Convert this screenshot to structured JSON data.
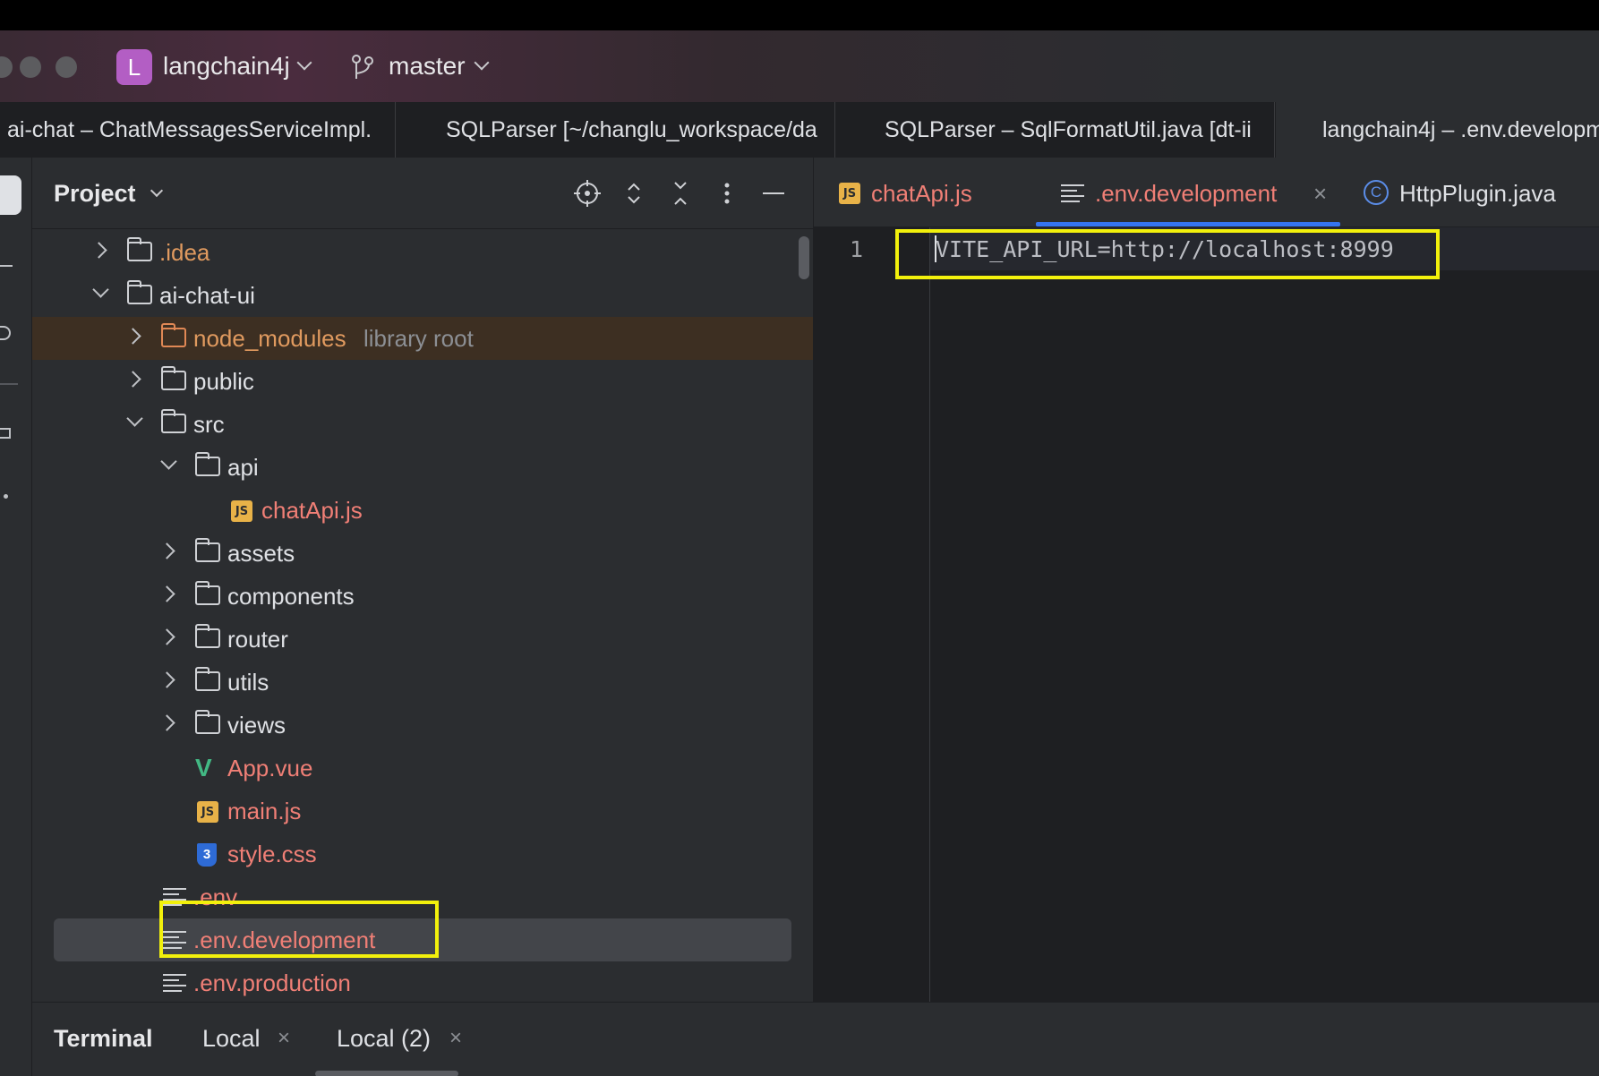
{
  "titlebar": {
    "project_initial": "L",
    "project_name": "langchain4j",
    "branch_name": "master"
  },
  "window_tabs": [
    {
      "label": "ai-chat – ChatMessagesServiceImpl."
    },
    {
      "label": "SQLParser [~/changlu_workspace/da"
    },
    {
      "label": "SQLParser – SqlFormatUtil.java [dt-ii"
    },
    {
      "label": "langchain4j – .env.developm"
    }
  ],
  "project_panel": {
    "title": "Project",
    "tree": [
      {
        "label": ".idea"
      },
      {
        "label": "ai-chat-ui"
      },
      {
        "label": "node_modules",
        "suffix": "library root"
      },
      {
        "label": "public"
      },
      {
        "label": "src"
      },
      {
        "label": "api"
      },
      {
        "label": "chatApi.js"
      },
      {
        "label": "assets"
      },
      {
        "label": "components"
      },
      {
        "label": "router"
      },
      {
        "label": "utils"
      },
      {
        "label": "views"
      },
      {
        "label": "App.vue"
      },
      {
        "label": "main.js"
      },
      {
        "label": "style.css"
      },
      {
        "label": ".env"
      },
      {
        "label": ".env.development"
      },
      {
        "label": ".env.production"
      }
    ]
  },
  "editor": {
    "tabs": [
      {
        "label": "chatApi.js",
        "icon": "js-icon"
      },
      {
        "label": ".env.development",
        "icon": "text-file-icon",
        "active": true
      },
      {
        "label": "HttpPlugin.java",
        "icon": "java-class-icon"
      }
    ],
    "lines": [
      {
        "number": "1",
        "code": "VITE_API_URL=http://localhost:8999"
      }
    ]
  },
  "terminal": {
    "title": "Terminal",
    "tabs": [
      {
        "label": "Local"
      },
      {
        "label": "Local (2)"
      }
    ]
  },
  "colors": {
    "highlight": "#f2f00c",
    "accent": "#3574f0",
    "modified_file": "#f07f76"
  }
}
